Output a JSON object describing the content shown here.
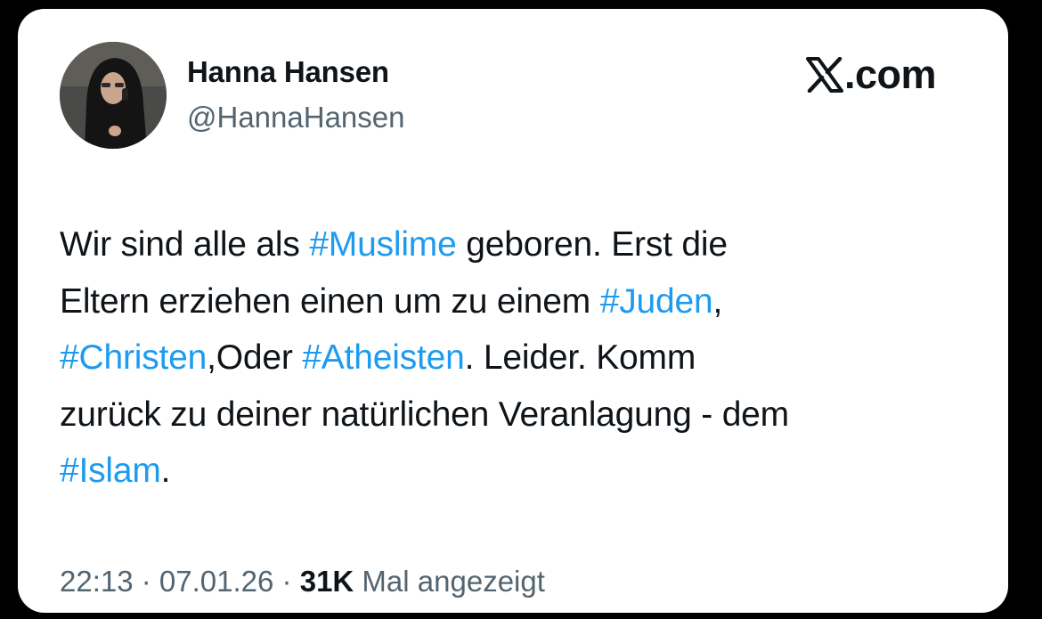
{
  "author": {
    "display_name": "Hanna Hansen",
    "handle": "@HannaHansen"
  },
  "brand": {
    "logo_icon": "x-logo-icon",
    "text": ".com"
  },
  "tweet": {
    "line1": {
      "pre": "Wir sind alle als ",
      "tag1": "#Muslime",
      "post": " geboren. Erst die"
    },
    "line2": {
      "pre": "Eltern erziehen einen um zu einem ",
      "tag1": "#Juden",
      "post": ","
    },
    "line3": {
      "tag1": "#Christen",
      "mid": ",Oder ",
      "tag2": "#Atheisten",
      "post": ". Leider. Komm"
    },
    "line4": {
      "pre": "zurück zu deiner natürlichen Veranlagung - dem"
    },
    "line5": {
      "tag1": "#Islam",
      "post": "."
    }
  },
  "meta": {
    "time": "22:13",
    "sep1": " · ",
    "date": "07.01.26",
    "sep2": " · ",
    "views_count": "31K",
    "views_label": " Mal angezeigt"
  },
  "colors": {
    "hashtag": "#1d9bf0",
    "text": "#0f1419",
    "secondary": "#536471",
    "background": "#000000",
    "card": "#ffffff"
  }
}
